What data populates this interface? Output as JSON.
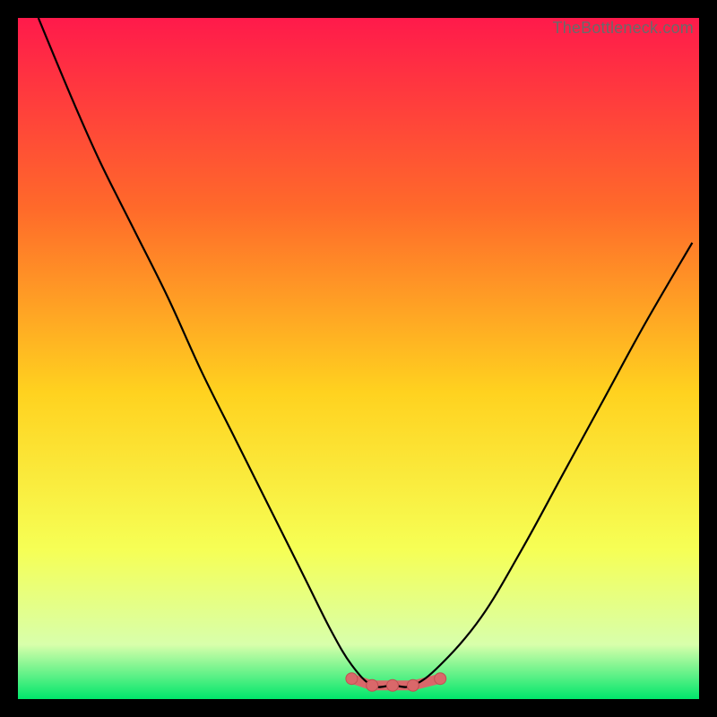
{
  "watermark": "TheBottleneck.com",
  "colors": {
    "bg_black": "#000000",
    "gradient_top": "#ff1a4b",
    "gradient_upper_mid": "#ff6a2a",
    "gradient_mid": "#ffd21f",
    "gradient_lower_mid": "#f6ff55",
    "gradient_low": "#d8ffab",
    "gradient_bottom": "#00e66b",
    "curve": "#000000",
    "marker_fill": "#d9686a",
    "marker_stroke": "#c24e52"
  },
  "chart_data": {
    "type": "line",
    "title": "",
    "xlabel": "",
    "ylabel": "",
    "xlim": [
      0,
      100
    ],
    "ylim": [
      0,
      100
    ],
    "series": [
      {
        "name": "bottleneck-curve",
        "x": [
          3,
          8,
          12,
          17,
          22,
          27,
          32,
          37,
          42,
          46,
          49,
          52,
          55,
          58,
          62,
          68,
          74,
          80,
          86,
          92,
          99
        ],
        "y": [
          100,
          88,
          79,
          69,
          59,
          48,
          38,
          28,
          18,
          10,
          5,
          2,
          2,
          2,
          5,
          12,
          22,
          33,
          44,
          55,
          67
        ]
      }
    ],
    "markers": {
      "name": "sweet-spot",
      "x": [
        49,
        52,
        55,
        58,
        62
      ],
      "y": [
        3,
        2,
        2,
        2,
        3
      ]
    }
  }
}
